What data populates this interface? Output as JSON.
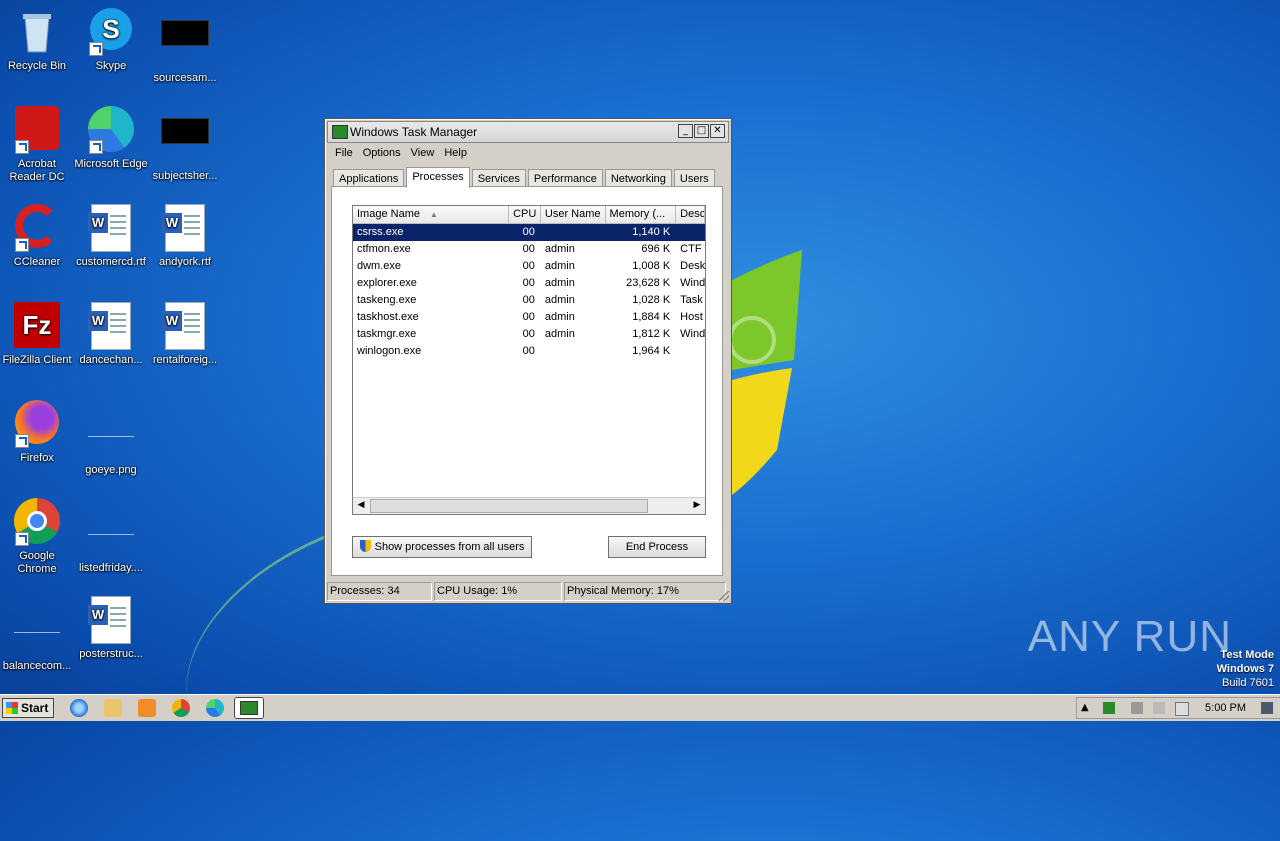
{
  "desktop": {
    "icons": [
      {
        "label": "Recycle Bin"
      },
      {
        "label": "Skype"
      },
      {
        "label": "sourcesam..."
      },
      {
        "label": "Acrobat Reader DC"
      },
      {
        "label": "Microsoft Edge"
      },
      {
        "label": "subjectsher..."
      },
      {
        "label": "CCleaner"
      },
      {
        "label": "customercd.rtf"
      },
      {
        "label": "andyork.rtf"
      },
      {
        "label": "FileZilla Client"
      },
      {
        "label": "dancechan..."
      },
      {
        "label": "rentalforeig..."
      },
      {
        "label": "Firefox"
      },
      {
        "label": "goeye.png"
      },
      {
        "label": "Google Chrome"
      },
      {
        "label": "listedfriday...."
      },
      {
        "label": "balancecom..."
      },
      {
        "label": "posterstruc..."
      }
    ]
  },
  "window": {
    "title": "Windows Task Manager",
    "menu": [
      "File",
      "Options",
      "View",
      "Help"
    ],
    "tabs": [
      "Applications",
      "Processes",
      "Services",
      "Performance",
      "Networking",
      "Users"
    ],
    "active_tab": "Processes",
    "columns": [
      "Image Name",
      "CPU",
      "User Name",
      "Memory (...",
      "Desc"
    ],
    "rows": [
      {
        "name": "csrss.exe",
        "cpu": "00",
        "user": "",
        "mem": "1,140 K",
        "desc": ""
      },
      {
        "name": "ctfmon.exe",
        "cpu": "00",
        "user": "admin",
        "mem": "696 K",
        "desc": "CTF L"
      },
      {
        "name": "dwm.exe",
        "cpu": "00",
        "user": "admin",
        "mem": "1,008 K",
        "desc": "Deskt"
      },
      {
        "name": "explorer.exe",
        "cpu": "00",
        "user": "admin",
        "mem": "23,628 K",
        "desc": "Wind"
      },
      {
        "name": "taskeng.exe",
        "cpu": "00",
        "user": "admin",
        "mem": "1,028 K",
        "desc": "Task"
      },
      {
        "name": "taskhost.exe",
        "cpu": "00",
        "user": "admin",
        "mem": "1,884 K",
        "desc": "Host"
      },
      {
        "name": "taskmgr.exe",
        "cpu": "00",
        "user": "admin",
        "mem": "1,812 K",
        "desc": "Wind"
      },
      {
        "name": "winlogon.exe",
        "cpu": "00",
        "user": "",
        "mem": "1,964 K",
        "desc": ""
      }
    ],
    "show_all_label": "Show processes from all users",
    "end_process_label": "End Process",
    "status": {
      "processes": "Processes: 34",
      "cpu": "CPU Usage: 1%",
      "memory": "Physical Memory: 17%"
    }
  },
  "taskbar": {
    "start_label": "Start",
    "clock": "5:00 PM"
  },
  "watermark": {
    "brand": "ANY RUN",
    "test_mode": "Test Mode",
    "os": "Windows 7",
    "build": "Build 7601"
  },
  "colors": {
    "selection": "#0a246a",
    "desktop_blue": "#1a6fd0"
  }
}
